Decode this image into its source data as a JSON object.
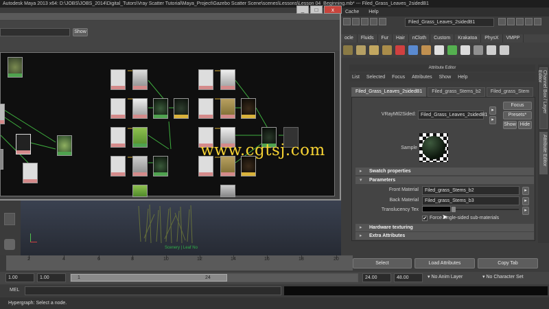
{
  "title_bar": {
    "title": "Autodesk Maya 2013 x64: D:\\JOBS\\JOBS_2014\\Digital_Tutors\\Vray Scatter Tutorial\\Maya_Project\\Gazebo Scatter Scene\\scenes\\Lessons\\Lesson 04_Beginning.mb*  ---  Filed_Grass_Leaves_2sidedB1"
  },
  "main_menu": [
    "Cache",
    "Help"
  ],
  "node_field": "Filed_Grass_Leaves_2sidedB1",
  "shelf_tabs": [
    "ocle",
    "Fluids",
    "Fur",
    "Hair",
    "nCloth",
    "Custom",
    "Krakatoa",
    "PhysX",
    "VMPP"
  ],
  "hypershade": {
    "show_label": "Show"
  },
  "window_buttons": {
    "minimize": "_",
    "maximize": "□",
    "close": "x"
  },
  "attribute_editor": {
    "title": "Attribute Editor",
    "menu": [
      "List",
      "Selected",
      "Focus",
      "Attributes",
      "Show",
      "Help"
    ],
    "tabs": [
      "Filed_Grass_Leaves_2sidedB1",
      "Filed_grass_Stems_b2",
      "Filed_grass_Stem"
    ],
    "node_type_label": "VRayMtl2Sided:",
    "node_name": "Filed_Grass_Leaves_2sidedB1",
    "focus_label": "Focus",
    "presets_label": "Presets*",
    "show_label": "Show",
    "hide_label": "Hide",
    "sample_label": "Sample",
    "sections": {
      "swatch": "Swatch properties",
      "parameters": "Parameters",
      "hardware": "Hardware texturing",
      "extra": "Extra Attributes"
    },
    "front_material_label": "Front Material",
    "front_material": "Filed_grass_Stems_b2",
    "back_material_label": "Back Material",
    "back_material": "Filed_grass_Stems_b3",
    "translucency_label": "Translucency Tex",
    "force_checkbox": "Force single-sided sub-materials",
    "force_checked": true
  },
  "side_tabs": [
    "Channel Box / Layer Editor",
    "Attribute Editor"
  ],
  "viewport": {
    "grass_label": "Scenery | Leaf No"
  },
  "timeline": {
    "ticks": [
      "2",
      "4",
      "6",
      "8",
      "10",
      "12",
      "14",
      "16",
      "18",
      "20"
    ]
  },
  "bottom_buttons": {
    "select": "Select",
    "load_attributes": "Load Attributes",
    "copy_tab": "Copy Tab"
  },
  "range": {
    "start": "1.00",
    "start2": "1.00",
    "current": "1",
    "end_marker": "24",
    "end": "24.00",
    "end2": "48.00",
    "anim_layer": "No Anim Layer",
    "character_set": "No Character Set"
  },
  "command_line": {
    "label": "MEL"
  },
  "help_line": "Hypergraph: Select a node.",
  "watermark": "www.cgtsj.com",
  "colors": {
    "accent_watermark": "#f6d233",
    "node_green": "#4fa24f",
    "node_pink": "#d48a8a"
  }
}
